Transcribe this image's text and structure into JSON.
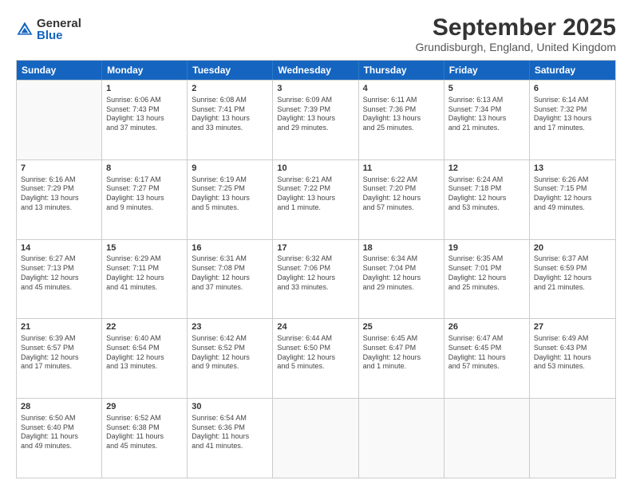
{
  "logo": {
    "general": "General",
    "blue": "Blue"
  },
  "title": "September 2025",
  "subtitle": "Grundisburgh, England, United Kingdom",
  "headers": [
    "Sunday",
    "Monday",
    "Tuesday",
    "Wednesday",
    "Thursday",
    "Friday",
    "Saturday"
  ],
  "rows": [
    [
      {
        "day": "",
        "lines": [],
        "empty": true
      },
      {
        "day": "1",
        "lines": [
          "Sunrise: 6:06 AM",
          "Sunset: 7:43 PM",
          "Daylight: 13 hours",
          "and 37 minutes."
        ],
        "empty": false
      },
      {
        "day": "2",
        "lines": [
          "Sunrise: 6:08 AM",
          "Sunset: 7:41 PM",
          "Daylight: 13 hours",
          "and 33 minutes."
        ],
        "empty": false
      },
      {
        "day": "3",
        "lines": [
          "Sunrise: 6:09 AM",
          "Sunset: 7:39 PM",
          "Daylight: 13 hours",
          "and 29 minutes."
        ],
        "empty": false
      },
      {
        "day": "4",
        "lines": [
          "Sunrise: 6:11 AM",
          "Sunset: 7:36 PM",
          "Daylight: 13 hours",
          "and 25 minutes."
        ],
        "empty": false
      },
      {
        "day": "5",
        "lines": [
          "Sunrise: 6:13 AM",
          "Sunset: 7:34 PM",
          "Daylight: 13 hours",
          "and 21 minutes."
        ],
        "empty": false
      },
      {
        "day": "6",
        "lines": [
          "Sunrise: 6:14 AM",
          "Sunset: 7:32 PM",
          "Daylight: 13 hours",
          "and 17 minutes."
        ],
        "empty": false
      }
    ],
    [
      {
        "day": "7",
        "lines": [
          "Sunrise: 6:16 AM",
          "Sunset: 7:29 PM",
          "Daylight: 13 hours",
          "and 13 minutes."
        ],
        "empty": false
      },
      {
        "day": "8",
        "lines": [
          "Sunrise: 6:17 AM",
          "Sunset: 7:27 PM",
          "Daylight: 13 hours",
          "and 9 minutes."
        ],
        "empty": false
      },
      {
        "day": "9",
        "lines": [
          "Sunrise: 6:19 AM",
          "Sunset: 7:25 PM",
          "Daylight: 13 hours",
          "and 5 minutes."
        ],
        "empty": false
      },
      {
        "day": "10",
        "lines": [
          "Sunrise: 6:21 AM",
          "Sunset: 7:22 PM",
          "Daylight: 13 hours",
          "and 1 minute."
        ],
        "empty": false
      },
      {
        "day": "11",
        "lines": [
          "Sunrise: 6:22 AM",
          "Sunset: 7:20 PM",
          "Daylight: 12 hours",
          "and 57 minutes."
        ],
        "empty": false
      },
      {
        "day": "12",
        "lines": [
          "Sunrise: 6:24 AM",
          "Sunset: 7:18 PM",
          "Daylight: 12 hours",
          "and 53 minutes."
        ],
        "empty": false
      },
      {
        "day": "13",
        "lines": [
          "Sunrise: 6:26 AM",
          "Sunset: 7:15 PM",
          "Daylight: 12 hours",
          "and 49 minutes."
        ],
        "empty": false
      }
    ],
    [
      {
        "day": "14",
        "lines": [
          "Sunrise: 6:27 AM",
          "Sunset: 7:13 PM",
          "Daylight: 12 hours",
          "and 45 minutes."
        ],
        "empty": false
      },
      {
        "day": "15",
        "lines": [
          "Sunrise: 6:29 AM",
          "Sunset: 7:11 PM",
          "Daylight: 12 hours",
          "and 41 minutes."
        ],
        "empty": false
      },
      {
        "day": "16",
        "lines": [
          "Sunrise: 6:31 AM",
          "Sunset: 7:08 PM",
          "Daylight: 12 hours",
          "and 37 minutes."
        ],
        "empty": false
      },
      {
        "day": "17",
        "lines": [
          "Sunrise: 6:32 AM",
          "Sunset: 7:06 PM",
          "Daylight: 12 hours",
          "and 33 minutes."
        ],
        "empty": false
      },
      {
        "day": "18",
        "lines": [
          "Sunrise: 6:34 AM",
          "Sunset: 7:04 PM",
          "Daylight: 12 hours",
          "and 29 minutes."
        ],
        "empty": false
      },
      {
        "day": "19",
        "lines": [
          "Sunrise: 6:35 AM",
          "Sunset: 7:01 PM",
          "Daylight: 12 hours",
          "and 25 minutes."
        ],
        "empty": false
      },
      {
        "day": "20",
        "lines": [
          "Sunrise: 6:37 AM",
          "Sunset: 6:59 PM",
          "Daylight: 12 hours",
          "and 21 minutes."
        ],
        "empty": false
      }
    ],
    [
      {
        "day": "21",
        "lines": [
          "Sunrise: 6:39 AM",
          "Sunset: 6:57 PM",
          "Daylight: 12 hours",
          "and 17 minutes."
        ],
        "empty": false
      },
      {
        "day": "22",
        "lines": [
          "Sunrise: 6:40 AM",
          "Sunset: 6:54 PM",
          "Daylight: 12 hours",
          "and 13 minutes."
        ],
        "empty": false
      },
      {
        "day": "23",
        "lines": [
          "Sunrise: 6:42 AM",
          "Sunset: 6:52 PM",
          "Daylight: 12 hours",
          "and 9 minutes."
        ],
        "empty": false
      },
      {
        "day": "24",
        "lines": [
          "Sunrise: 6:44 AM",
          "Sunset: 6:50 PM",
          "Daylight: 12 hours",
          "and 5 minutes."
        ],
        "empty": false
      },
      {
        "day": "25",
        "lines": [
          "Sunrise: 6:45 AM",
          "Sunset: 6:47 PM",
          "Daylight: 12 hours",
          "and 1 minute."
        ],
        "empty": false
      },
      {
        "day": "26",
        "lines": [
          "Sunrise: 6:47 AM",
          "Sunset: 6:45 PM",
          "Daylight: 11 hours",
          "and 57 minutes."
        ],
        "empty": false
      },
      {
        "day": "27",
        "lines": [
          "Sunrise: 6:49 AM",
          "Sunset: 6:43 PM",
          "Daylight: 11 hours",
          "and 53 minutes."
        ],
        "empty": false
      }
    ],
    [
      {
        "day": "28",
        "lines": [
          "Sunrise: 6:50 AM",
          "Sunset: 6:40 PM",
          "Daylight: 11 hours",
          "and 49 minutes."
        ],
        "empty": false
      },
      {
        "day": "29",
        "lines": [
          "Sunrise: 6:52 AM",
          "Sunset: 6:38 PM",
          "Daylight: 11 hours",
          "and 45 minutes."
        ],
        "empty": false
      },
      {
        "day": "30",
        "lines": [
          "Sunrise: 6:54 AM",
          "Sunset: 6:36 PM",
          "Daylight: 11 hours",
          "and 41 minutes."
        ],
        "empty": false
      },
      {
        "day": "",
        "lines": [],
        "empty": true
      },
      {
        "day": "",
        "lines": [],
        "empty": true
      },
      {
        "day": "",
        "lines": [],
        "empty": true
      },
      {
        "day": "",
        "lines": [],
        "empty": true
      }
    ]
  ]
}
